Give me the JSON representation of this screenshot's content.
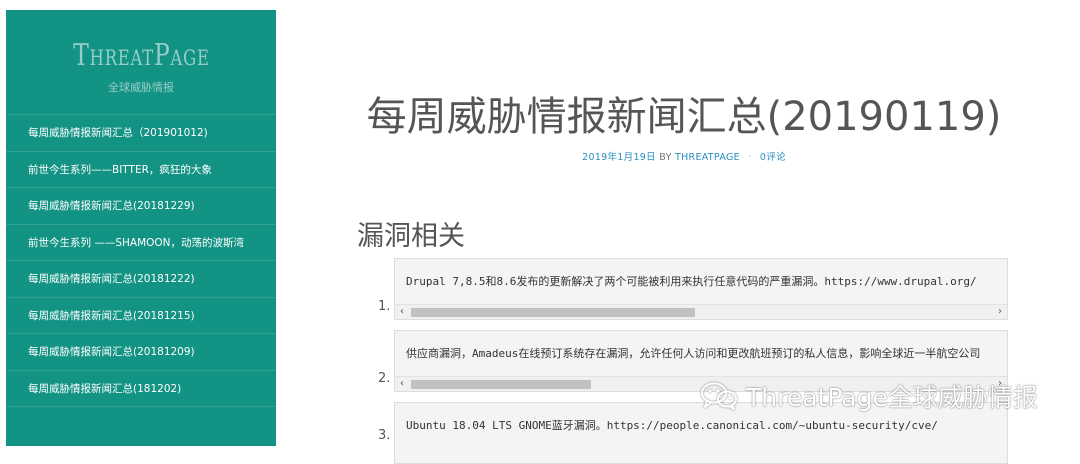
{
  "sidebar": {
    "brand_title": "ThreatPage",
    "brand_subtitle": "全球威胁情报",
    "items": [
      {
        "label": "每周威胁情报新闻汇总（201901012)"
      },
      {
        "label": "前世今生系列——BITTER，疯狂的大象"
      },
      {
        "label": "每周威胁情报新闻汇总(20181229)"
      },
      {
        "label": "前世今生系列 ——SHAMOON，动荡的波斯湾"
      },
      {
        "label": "每周威胁情报新闻汇总(20181222)"
      },
      {
        "label": "每周威胁情报新闻汇总(20181215)"
      },
      {
        "label": "每周威胁情报新闻汇总(20181209)"
      },
      {
        "label": "每周威胁情报新闻汇总(181202)"
      }
    ]
  },
  "post": {
    "title": "每周威胁情报新闻汇总(20190119)",
    "date": "2019年1月19日",
    "by": "BY",
    "author": "THREATPAGE",
    "separator": "·",
    "comments": "0评论"
  },
  "section": {
    "heading": "漏洞相关",
    "items": [
      {
        "num": "1.",
        "text": "Drupal 7,8.5和8.6发布的更新解决了两个可能被利用来执行任意代码的严重漏洞。https://www.drupal.org/",
        "scroll_fraction": 0.49
      },
      {
        "num": "2.",
        "text": "供应商漏洞，Amadeus在线预订系统存在漏洞，允许任何人访问和更改航班预订的私人信息，影响全球近一半航空公司",
        "scroll_fraction": 0.31
      },
      {
        "num": "3.",
        "text": "Ubuntu 18.04 LTS GNOME蓝牙漏洞。https://people.canonical.com/~ubuntu-security/cve/",
        "scroll_fraction": null
      }
    ]
  },
  "scrollbar": {
    "left_arrow": "‹",
    "right_arrow": "›"
  },
  "watermark": {
    "text": "ThreatPage全球威胁情报",
    "icon": "wechat-icon"
  },
  "colors": {
    "sidebar_bg": "#139383",
    "link": "#2a8fc1",
    "title": "#555555"
  }
}
